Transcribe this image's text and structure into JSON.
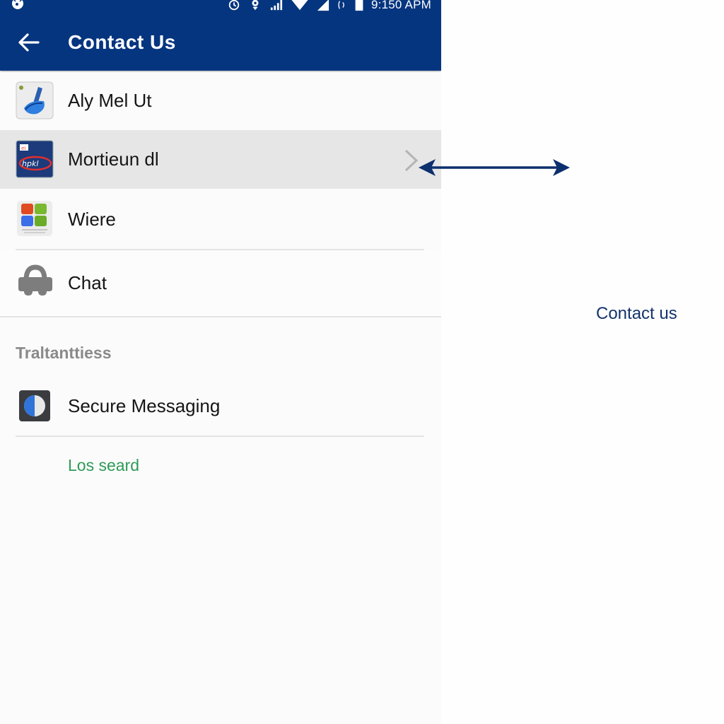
{
  "statusbar": {
    "time": "9:150 APM",
    "icons": [
      "notification-icon",
      "alarm-icon",
      "location-icon",
      "signal-bars-icon",
      "wifi-icon",
      "cell-signal-icon",
      "vibrate-icon",
      "battery-icon"
    ]
  },
  "appbar": {
    "title": "Contact Us",
    "back_icon": "arrow-left-icon",
    "background_color": "#05357f"
  },
  "list": {
    "items": [
      {
        "label": "Aly Mel Ut",
        "icon": "app-logo-blue-icon"
      },
      {
        "label": "Mortieun dl",
        "icon": "brand-badge-icon",
        "selected": true,
        "trailing_icon": "chevron-right-icon"
      },
      {
        "label": "Wiere",
        "icon": "color-grid-icon"
      },
      {
        "label": "Chat",
        "icon": "chat-bubble-icon"
      }
    ]
  },
  "section": {
    "header": "Traltanttiess",
    "items": [
      {
        "label": "Secure Messaging",
        "icon": "half-circle-icon"
      }
    ],
    "link": "Los seard",
    "link_color": "#2f9a57"
  },
  "annotation": {
    "arrow_icon": "double-headed-arrow-icon",
    "label": "Contact us",
    "color": "#15336b"
  }
}
